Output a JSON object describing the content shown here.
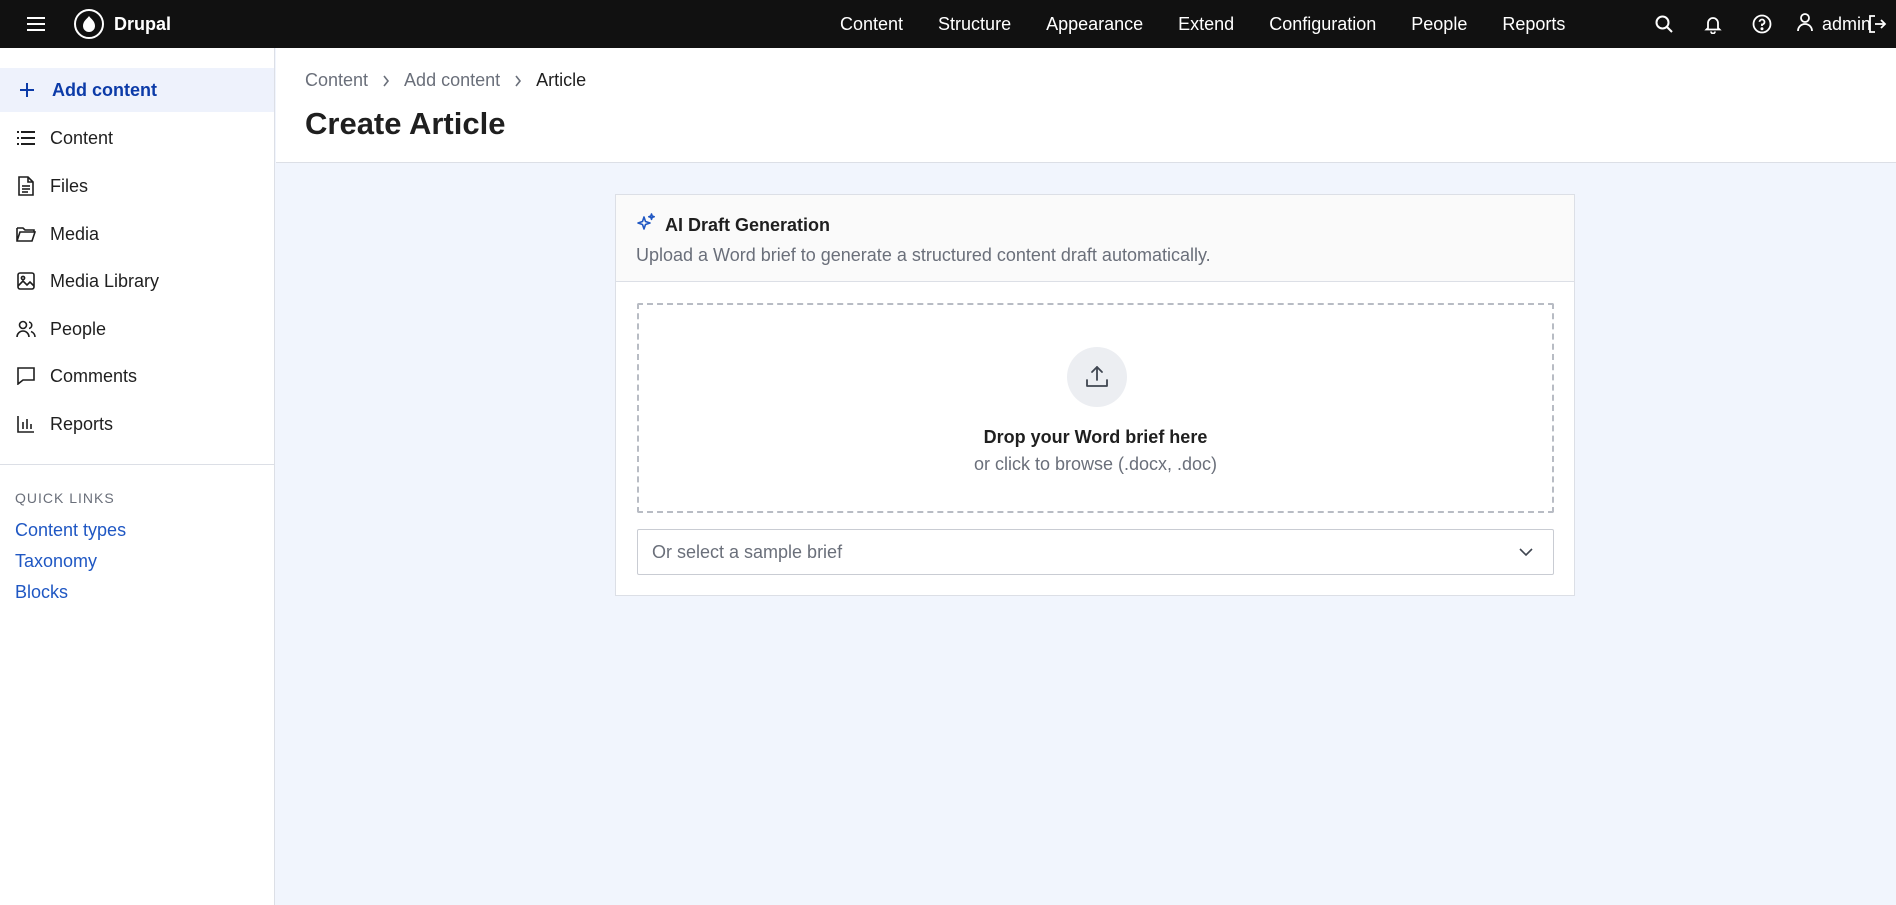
{
  "topbar": {
    "brand": "Drupal",
    "nav": [
      "Content",
      "Structure",
      "Appearance",
      "Extend",
      "Configuration",
      "People",
      "Reports"
    ],
    "user": "admin",
    "icons": [
      "menu-icon",
      "search-icon",
      "bell-icon",
      "help-icon",
      "user-icon",
      "logout-icon"
    ]
  },
  "sidebar": {
    "items": [
      {
        "label": "Add content",
        "icon": "plus-icon"
      },
      {
        "label": "Content",
        "icon": "list-icon"
      },
      {
        "label": "Files",
        "icon": "file-icon"
      },
      {
        "label": "Media",
        "icon": "folder-icon"
      },
      {
        "label": "Media Library",
        "icon": "image-icon"
      },
      {
        "label": "People",
        "icon": "people-icon"
      },
      {
        "label": "Comments",
        "icon": "comment-icon"
      },
      {
        "label": "Reports",
        "icon": "bar-chart-icon"
      }
    ],
    "quick_links_title": "QUICK LINKS",
    "quick_links": [
      "Content types",
      "Taxonomy",
      "Blocks"
    ]
  },
  "header": {
    "breadcrumb": [
      "Content",
      "Add content",
      "Article"
    ],
    "title": "Create Article"
  },
  "card": {
    "title": "AI Draft Generation",
    "subtitle": "Upload a Word brief to generate a structured content draft automatically.",
    "drop_title": "Drop your Word brief here",
    "drop_sub": "or click to browse (.docx, .doc)",
    "select_placeholder": "Or select a sample brief"
  },
  "colors": {
    "topbar": "#111111",
    "accent": "#0c3ba8",
    "link": "#1f57c3",
    "page_bg": "#f1f5fd"
  }
}
